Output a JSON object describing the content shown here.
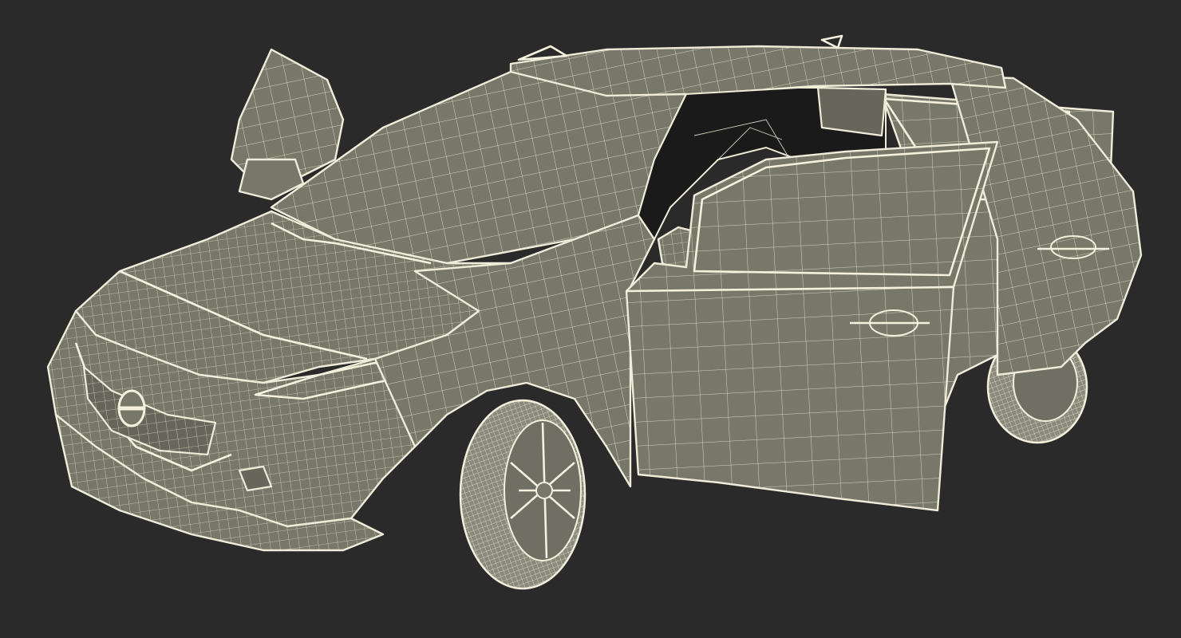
{
  "scene": {
    "subject": "3d-wireframe-car-model",
    "colors": {
      "background": "#2a2a2a",
      "panel": "#77776a",
      "wire": "#efecd9",
      "interior": "#1a1a1a"
    }
  }
}
